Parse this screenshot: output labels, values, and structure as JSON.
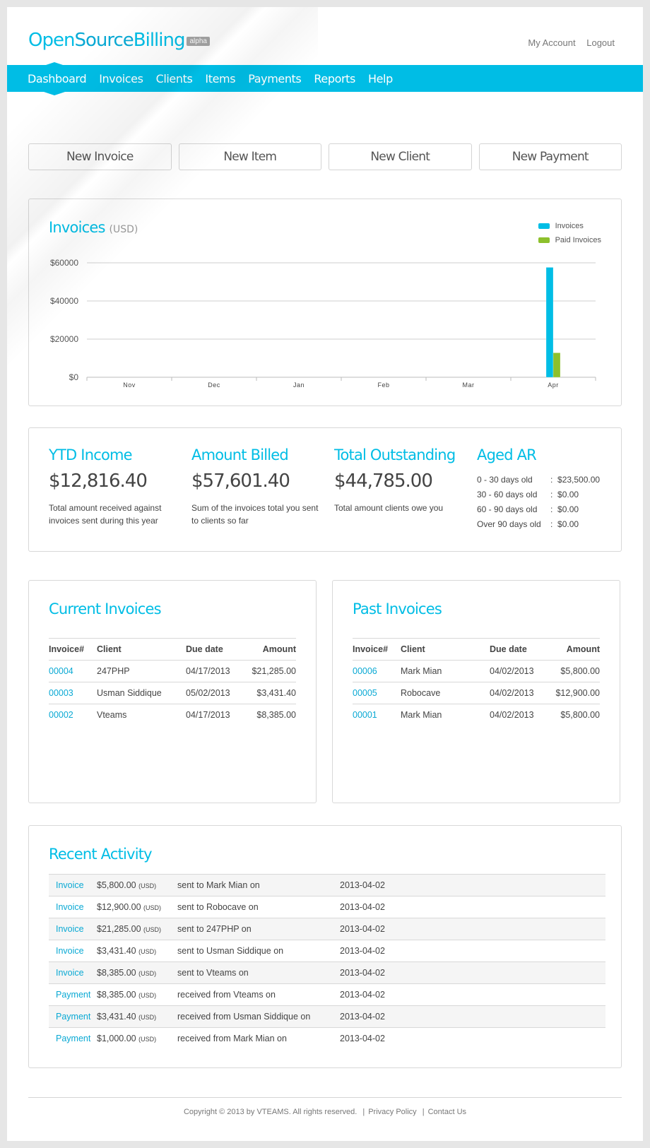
{
  "app": {
    "logo_part1": "Open",
    "logo_part2": "Source",
    "logo_part3": "Billing",
    "badge": "alpha",
    "accent_color": "#00bde5",
    "paid_color": "#8dc02c"
  },
  "toplinks": {
    "my_account": "My Account",
    "logout": "Logout"
  },
  "nav": {
    "items": [
      {
        "label": "Dashboard",
        "active": true
      },
      {
        "label": "Invoices"
      },
      {
        "label": "Clients"
      },
      {
        "label": "Items"
      },
      {
        "label": "Payments"
      },
      {
        "label": "Reports"
      },
      {
        "label": "Help"
      }
    ]
  },
  "actions": {
    "new_invoice": "New Invoice",
    "new_item": "New Item",
    "new_client": "New Client",
    "new_payment": "New Payment"
  },
  "chart_panel": {
    "title": "Invoices",
    "unit": "(USD)"
  },
  "chart_data": {
    "type": "bar",
    "title": "Invoices (USD)",
    "categories": [
      "Nov",
      "Dec",
      "Jan",
      "Feb",
      "Mar",
      "Apr"
    ],
    "series": [
      {
        "name": "Invoices",
        "color": "#00bde5",
        "values": [
          0,
          0,
          0,
          0,
          0,
          57601.4
        ]
      },
      {
        "name": "Paid Invoices",
        "color": "#8dc02c",
        "values": [
          0,
          0,
          0,
          0,
          0,
          12816.4
        ]
      }
    ],
    "yticks": [
      0,
      20000,
      40000,
      60000
    ],
    "ytick_labels": [
      "$0",
      "$20000",
      "$40000",
      "$60000"
    ],
    "ylim": [
      0,
      60000
    ],
    "xlabel": "",
    "ylabel": "",
    "grid": true,
    "legend": "top-right"
  },
  "stats": {
    "ytd": {
      "title": "YTD Income",
      "value": "$12,816.40",
      "desc": "Total amount received against invoices sent during this year"
    },
    "billed": {
      "title": "Amount Billed",
      "value": "$57,601.40",
      "desc": "Sum of the invoices total you sent to clients so far"
    },
    "outstanding": {
      "title": "Total Outstanding",
      "value": "$44,785.00",
      "desc": "Total amount clients owe you"
    },
    "aged": {
      "title": "Aged AR",
      "rows": [
        {
          "label": "0 - 30 days old",
          "value": "$23,500.00"
        },
        {
          "label": "30 - 60 days old",
          "value": "$0.00"
        },
        {
          "label": "60 - 90 days old",
          "value": "$0.00"
        },
        {
          "label": "Over 90 days old",
          "value": "$0.00"
        }
      ]
    }
  },
  "current_invoices": {
    "title": "Current Invoices",
    "columns": [
      "Invoice#",
      "Client",
      "Due date",
      "Amount"
    ],
    "rows": [
      {
        "number": "00004",
        "client": "247PHP",
        "due": "04/17/2013",
        "amount": "$21,285.00"
      },
      {
        "number": "00003",
        "client": "Usman Siddique",
        "due": "05/02/2013",
        "amount": "$3,431.40"
      },
      {
        "number": "00002",
        "client": "Vteams",
        "due": "04/17/2013",
        "amount": "$8,385.00"
      }
    ]
  },
  "past_invoices": {
    "title": "Past Invoices",
    "columns": [
      "Invoice#",
      "Client",
      "Due date",
      "Amount"
    ],
    "rows": [
      {
        "number": "00006",
        "client": "Mark Mian",
        "due": "04/02/2013",
        "amount": "$5,800.00"
      },
      {
        "number": "00005",
        "client": "Robocave",
        "due": "04/02/2013",
        "amount": "$12,900.00"
      },
      {
        "number": "00001",
        "client": "Mark Mian",
        "due": "04/02/2013",
        "amount": "$5,800.00"
      }
    ]
  },
  "activity": {
    "title": "Recent Activity",
    "currency": "(USD)",
    "rows": [
      {
        "type": "Invoice",
        "amount": "$5,800.00",
        "text": "sent to Mark Mian on",
        "date": "2013-04-02"
      },
      {
        "type": "Invoice",
        "amount": "$12,900.00",
        "text": "sent to Robocave on",
        "date": "2013-04-02"
      },
      {
        "type": "Invoice",
        "amount": "$21,285.00",
        "text": "sent to 247PHP on",
        "date": "2013-04-02"
      },
      {
        "type": "Invoice",
        "amount": "$3,431.40",
        "text": "sent to Usman Siddique on",
        "date": "2013-04-02"
      },
      {
        "type": "Invoice",
        "amount": "$8,385.00",
        "text": "sent to Vteams on",
        "date": "2013-04-02"
      },
      {
        "type": "Payment",
        "amount": "$8,385.00",
        "text": "received from Vteams on",
        "date": "2013-04-02"
      },
      {
        "type": "Payment",
        "amount": "$3,431.40",
        "text": "received from Usman Siddique on",
        "date": "2013-04-02"
      },
      {
        "type": "Payment",
        "amount": "$1,000.00",
        "text": "received from Mark Mian on",
        "date": "2013-04-02"
      }
    ]
  },
  "footer": {
    "copyright": "Copyright © 2013 by VTEAMS. All rights reserved.",
    "privacy": "Privacy Policy",
    "contact": "Contact Us",
    "separator": "|"
  }
}
